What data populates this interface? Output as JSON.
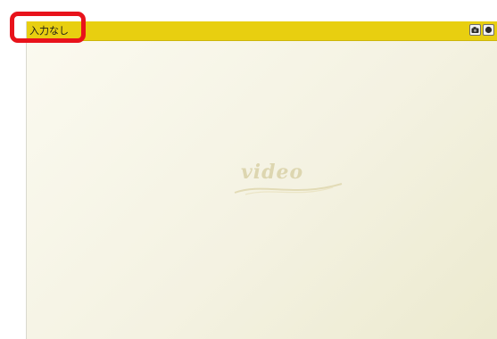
{
  "window": {
    "input_status": "入力なし"
  },
  "controls": {
    "snapshot_icon": "camera-icon",
    "record_icon": "record-icon"
  },
  "video": {
    "placeholder": "video"
  },
  "colors": {
    "title_bar": "#e8cf10",
    "highlight": "#e8131b",
    "panel_background": "#f6f4e6"
  }
}
